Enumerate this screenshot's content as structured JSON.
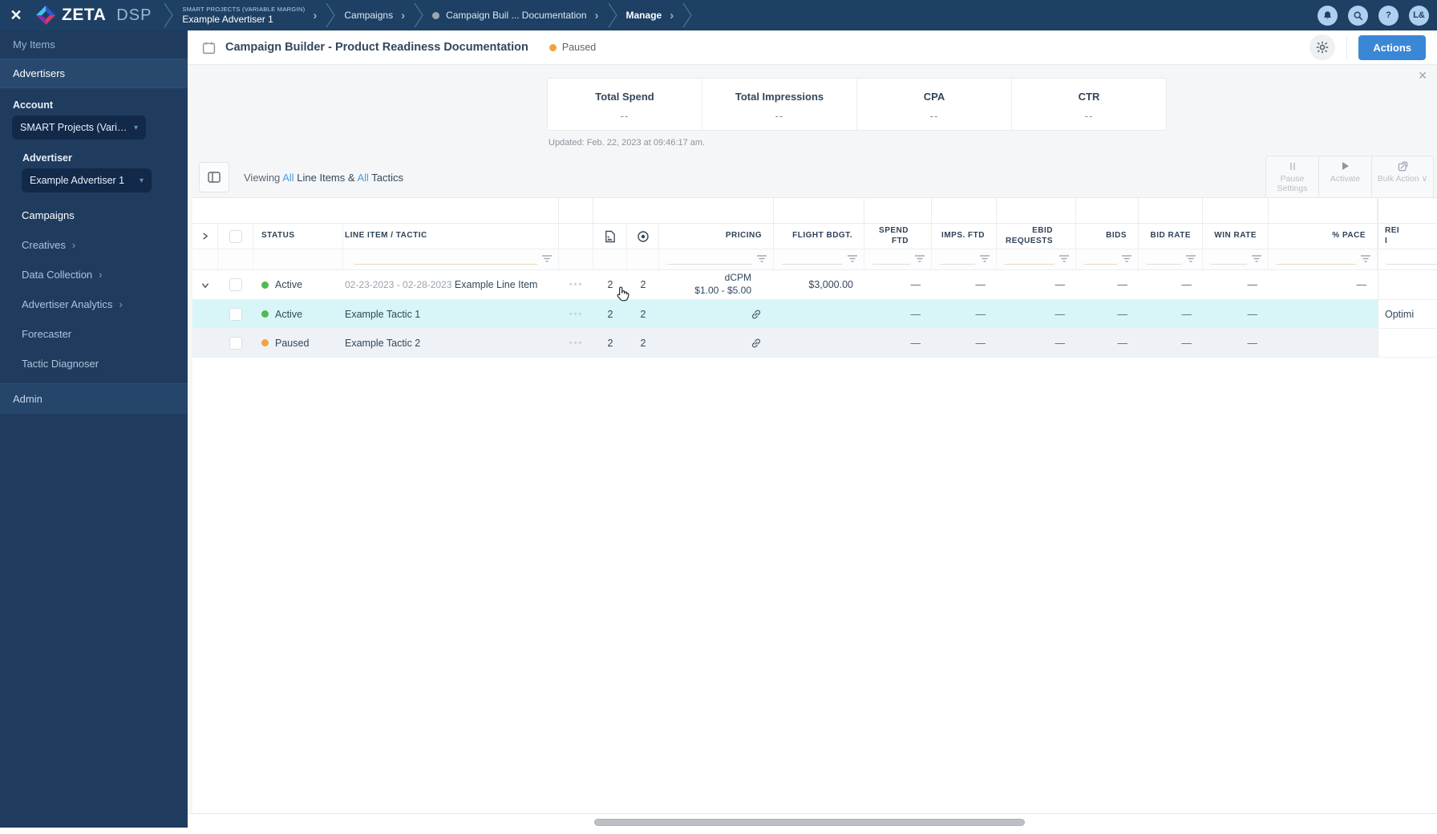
{
  "colors": {
    "accent_blue": "#3a87d6",
    "status_green": "#52b852",
    "status_orange": "#f0a43c",
    "row_highlight_cyan": "#d8f6f7",
    "topbar_navy": "#1d4064",
    "sidebar_navy": "#1f3c5e"
  },
  "topbar": {
    "brand_primary": "ZETA",
    "brand_secondary": "DSP",
    "breadcrumbs": {
      "account_small": "SMART PROJECTS (VARIABLE MARGIN)",
      "advertiser": "Example Advertiser 1",
      "campaigns": "Campaigns",
      "campaign": "Campaign Buil ... Documentation",
      "manage": "Manage"
    },
    "avatar_initials": "L&"
  },
  "sidebar": {
    "my_items": "My Items",
    "advertisers": "Advertisers",
    "account_label": "Account",
    "account_value": "SMART Projects (Variable M...",
    "advertiser_label": "Advertiser",
    "advertiser_value": "Example Advertiser 1",
    "campaigns": "Campaigns",
    "creatives": "Creatives",
    "data_collection": "Data Collection",
    "advertiser_analytics": "Advertiser Analytics",
    "forecaster": "Forecaster",
    "tactic_diagnoser": "Tactic Diagnoser",
    "admin": "Admin"
  },
  "header": {
    "title": "Campaign Builder - Product Readiness Documentation",
    "status": "Paused",
    "actions_label": "Actions"
  },
  "summary": {
    "stats": [
      {
        "label": "Total Spend",
        "value": "--"
      },
      {
        "label": "Total Impressions",
        "value": "--"
      },
      {
        "label": "CPA",
        "value": "--"
      },
      {
        "label": "CTR",
        "value": "--"
      }
    ],
    "updated": "Updated: Feb. 22, 2023 at 09:46:17 am."
  },
  "toolbar": {
    "viewing": "Viewing",
    "all_1": "All",
    "mid": "Line Items &",
    "all_2": "All",
    "tail": "Tactics",
    "pause_settings": "Pause Settings",
    "activate": "Activate",
    "bulk_action": "Bulk Action ∨"
  },
  "table": {
    "headers": {
      "status": "STATUS",
      "line_item": "LINE ITEM / TACTIC",
      "pricing": "PRICING",
      "flight": "FLIGHT BDGT.",
      "spend_l1": "SPEND",
      "spend_l2": "FTD",
      "imps": "IMPS. FTD",
      "ebid_l1": "EBID",
      "ebid_l2": "REQUESTS",
      "bids": "BIDS",
      "bid_rate": "BID RATE",
      "win_rate": "WIN RATE",
      "pace": "% PACE",
      "last_l1": "REI",
      "last_l2": "I"
    },
    "rows": [
      {
        "status": "Active",
        "date_range": "02-23-2023 - 02-28-2023",
        "name": "Example Line Item",
        "creatives": "2",
        "targets": "2",
        "pricing_l1": "dCPM",
        "pricing_l2": "$1.00 - $5.00",
        "flight": "$3,000.00",
        "spend": "—",
        "imps": "—",
        "ebid": "—",
        "bids": "—",
        "bid_rate": "—",
        "win_rate": "—",
        "pace": "—",
        "last": ""
      },
      {
        "status": "Active",
        "name": "Example Tactic 1",
        "creatives": "2",
        "targets": "2",
        "flight": "",
        "spend": "—",
        "imps": "—",
        "ebid": "—",
        "bids": "—",
        "bid_rate": "—",
        "win_rate": "—",
        "pace": "",
        "last": "Optimi"
      },
      {
        "status": "Paused",
        "name": "Example Tactic 2",
        "creatives": "2",
        "targets": "2",
        "flight": "",
        "spend": "—",
        "imps": "—",
        "ebid": "—",
        "bids": "—",
        "bid_rate": "—",
        "win_rate": "—",
        "pace": "",
        "last": ""
      }
    ]
  }
}
